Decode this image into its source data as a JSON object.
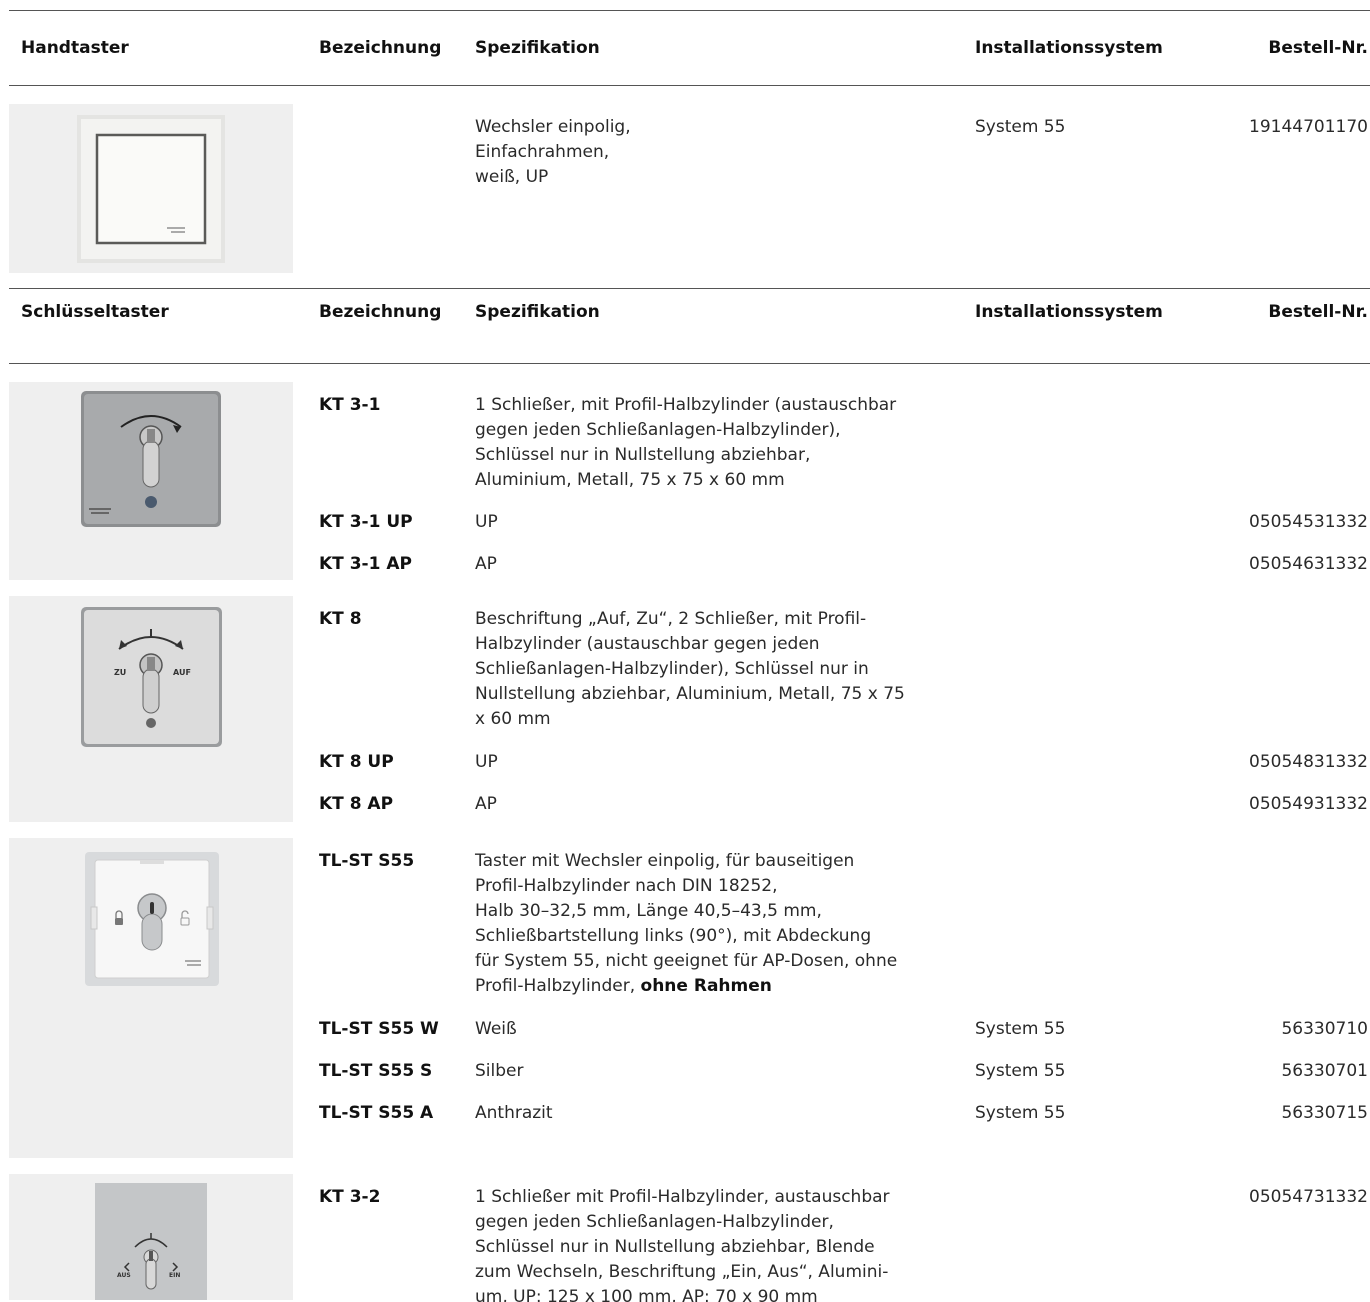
{
  "section1": {
    "headers": [
      "Handtaster",
      "Bezeichnung",
      "Spezifikation",
      "Installationssystem",
      "Bestell-Nr."
    ],
    "row": {
      "spec_lines": [
        "Wechsler einpolig,",
        "Einfachrahmen,",
        "weiß, UP"
      ],
      "system": "System 55",
      "order_no": "19144701170"
    }
  },
  "section2": {
    "headers": [
      "Schlüsseltaster",
      "Bezeichnung",
      "Spezifikation",
      "Installationssystem",
      "Bestell-Nr."
    ],
    "groups": [
      {
        "name": "KT 3-1",
        "spec_lines": [
          "1 Schließer, mit Profil-Halbzylinder (austauschbar",
          "gegen jeden Schließanlagen-Halbzylinder),",
          "Schlüssel nur in Nullstellung abziehbar,",
          "Aluminium, Metall, 75 x 75 x 60 mm"
        ],
        "variants": [
          {
            "name": "KT 3-1 UP",
            "spec": "UP",
            "system": "",
            "order_no": "05054531332"
          },
          {
            "name": "KT 3-1 AP",
            "spec": "AP",
            "system": "",
            "order_no": "05054631332"
          }
        ],
        "image_labels": {
          "arrow": "",
          "left": "",
          "right": ""
        }
      },
      {
        "name": "KT 8",
        "spec_lines": [
          "Beschriftung „Auf, Zu“, 2 Schließer, mit Profil-",
          "Halbzylinder (austauschbar gegen jeden",
          "Schließanlagen-Halbzylinder), Schlüssel nur in",
          "Nullstellung abziehbar, Aluminium, Metall, 75 x 75",
          "x 60 mm"
        ],
        "variants": [
          {
            "name": "KT 8 UP",
            "spec": "UP",
            "system": "",
            "order_no": "05054831332"
          },
          {
            "name": "KT 8 AP",
            "spec": "AP",
            "system": "",
            "order_no": "05054931332"
          }
        ],
        "image_labels": {
          "left": "ZU",
          "right": "AUF"
        }
      },
      {
        "name": "TL-ST S55",
        "spec_lines": [
          "Taster mit Wechsler einpolig, für bauseitigen",
          "Profil-Halbzylinder nach DIN 18252,",
          "Halb 30–32,5 mm, Länge 40,5–43,5 mm,",
          "Schließbartstellung links (90°), mit Abdeckung",
          "für System 55, nicht geeignet für AP-Dosen, ohne"
        ],
        "spec_last_prefix": "Profil-Halbzylinder, ",
        "spec_last_bold": "ohne Rahmen",
        "variants": [
          {
            "name": "TL-ST S55 W",
            "spec": "Weiß",
            "system": "System 55",
            "order_no": "56330710"
          },
          {
            "name": "TL-ST S55 S",
            "spec": "Silber",
            "system": "System 55",
            "order_no": "56330701"
          },
          {
            "name": "TL-ST S55 A",
            "spec": "Anthrazit",
            "system": "System 55",
            "order_no": "56330715"
          }
        ]
      },
      {
        "name": "KT 3-2",
        "spec_lines": [
          "1 Schließer mit Profil-Halbzylinder, austauschbar",
          "gegen jeden Schließanlagen-Halbzylinder,",
          "Schlüssel nur in Nullstellung abziehbar, Blende",
          "zum Wechseln, Beschriftung „Ein, Aus“, Alumini-",
          "um, UP: 125 x 100 mm, AP: 70 x 90 mm"
        ],
        "order_no": "05054731332",
        "image_labels": {
          "left": "AUS",
          "right": "EIN"
        }
      }
    ]
  }
}
